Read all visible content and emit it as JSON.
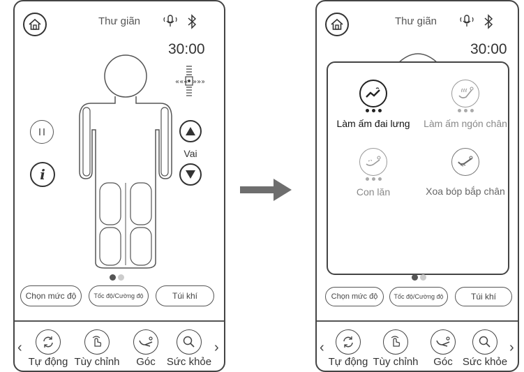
{
  "left_screen": {
    "title": "Thư giãn",
    "timer": "30:00",
    "position_label": "Vai",
    "bottom_buttons": [
      "Chọn mức độ",
      "Tốc độ/Cường độ",
      "Túi khí"
    ],
    "nav": [
      "Tự động",
      "Tùy chỉnh",
      "Góc",
      "Sức khỏe"
    ],
    "nav_prev": "‹",
    "nav_next": "›",
    "info_label": "i",
    "page_index": 1,
    "page_count": 2
  },
  "right_screen": {
    "title": "Thư giãn",
    "timer": "30:00",
    "modes": [
      {
        "label": "Làm ấm đai lưng",
        "active": true,
        "icon": "back-heat-icon"
      },
      {
        "label": "Làm ấm ngón chân",
        "active": false,
        "icon": "foot-heat-icon"
      },
      {
        "label": "Con lăn",
        "active": false,
        "icon": "roller-icon"
      },
      {
        "label": "Xoa bóp bắp chân",
        "active": false,
        "icon": "calf-massage-icon"
      }
    ],
    "bottom_buttons": [
      "Chọn mức độ",
      "Tốc độ/Cường độ",
      "Túi khí"
    ],
    "nav": [
      "Tự động",
      "Tùy chỉnh",
      "Góc",
      "Sức khỏe"
    ],
    "nav_prev": "‹",
    "nav_next": "›",
    "page_index": 1,
    "page_count": 2
  },
  "colors": {
    "border": "#444444",
    "text": "#333333",
    "inactive": "#999999",
    "dot_active": "#555555",
    "dot_inactive": "#cccccc",
    "arrow": "#6e6e6e"
  }
}
